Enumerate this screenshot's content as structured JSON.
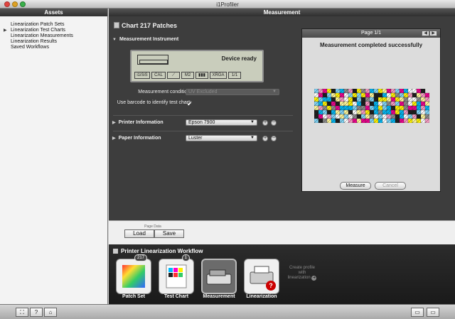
{
  "window": {
    "title": "i1Profiler"
  },
  "assets": {
    "header": "Assets",
    "items": [
      {
        "label": "Linearization Patch Sets",
        "selected": false
      },
      {
        "label": "Linearization Test Charts",
        "selected": true
      },
      {
        "label": "Linearization Measurements",
        "selected": false
      },
      {
        "label": "Linearization Results",
        "selected": false
      },
      {
        "label": "Saved Workflows",
        "selected": false
      }
    ]
  },
  "main": {
    "header": "Measurement",
    "chart_title": "Chart 217 Patches",
    "instrument": {
      "section_label": "Measurement Instrument",
      "lcd_status": "Device ready",
      "lcd_segments": [
        "i1iSiS",
        "CAL",
        "",
        "M2",
        "",
        "XRGA",
        "1/1"
      ]
    },
    "measurement_condition": {
      "label": "Measurement condition:",
      "value": "UV Excluded"
    },
    "barcode": {
      "label": "Use barcode to identify test chart:",
      "checked": true
    },
    "printer": {
      "section_label": "Printer Information",
      "value": "Epson 7900"
    },
    "paper": {
      "section_label": "Paper Information",
      "value": "Luster"
    }
  },
  "preview": {
    "page_label": "Page 1/1",
    "message": "Measurement completed successfully",
    "measure_label": "Measure",
    "cancel_label": "Cancel"
  },
  "page_data": {
    "label": "Page Data",
    "load_label": "Load",
    "save_label": "Save"
  },
  "workflow": {
    "title": "Printer Linearization Workflow",
    "steps": [
      {
        "label": "Patch Set",
        "badge": "217"
      },
      {
        "label": "Test Chart",
        "badge": "1"
      },
      {
        "label": "Measurement",
        "badge": ""
      },
      {
        "label": "Linearization",
        "badge": ""
      }
    ],
    "create_profile_text": "Create profile with linearization"
  },
  "bottom_toolbar": {
    "help_label": "?"
  }
}
